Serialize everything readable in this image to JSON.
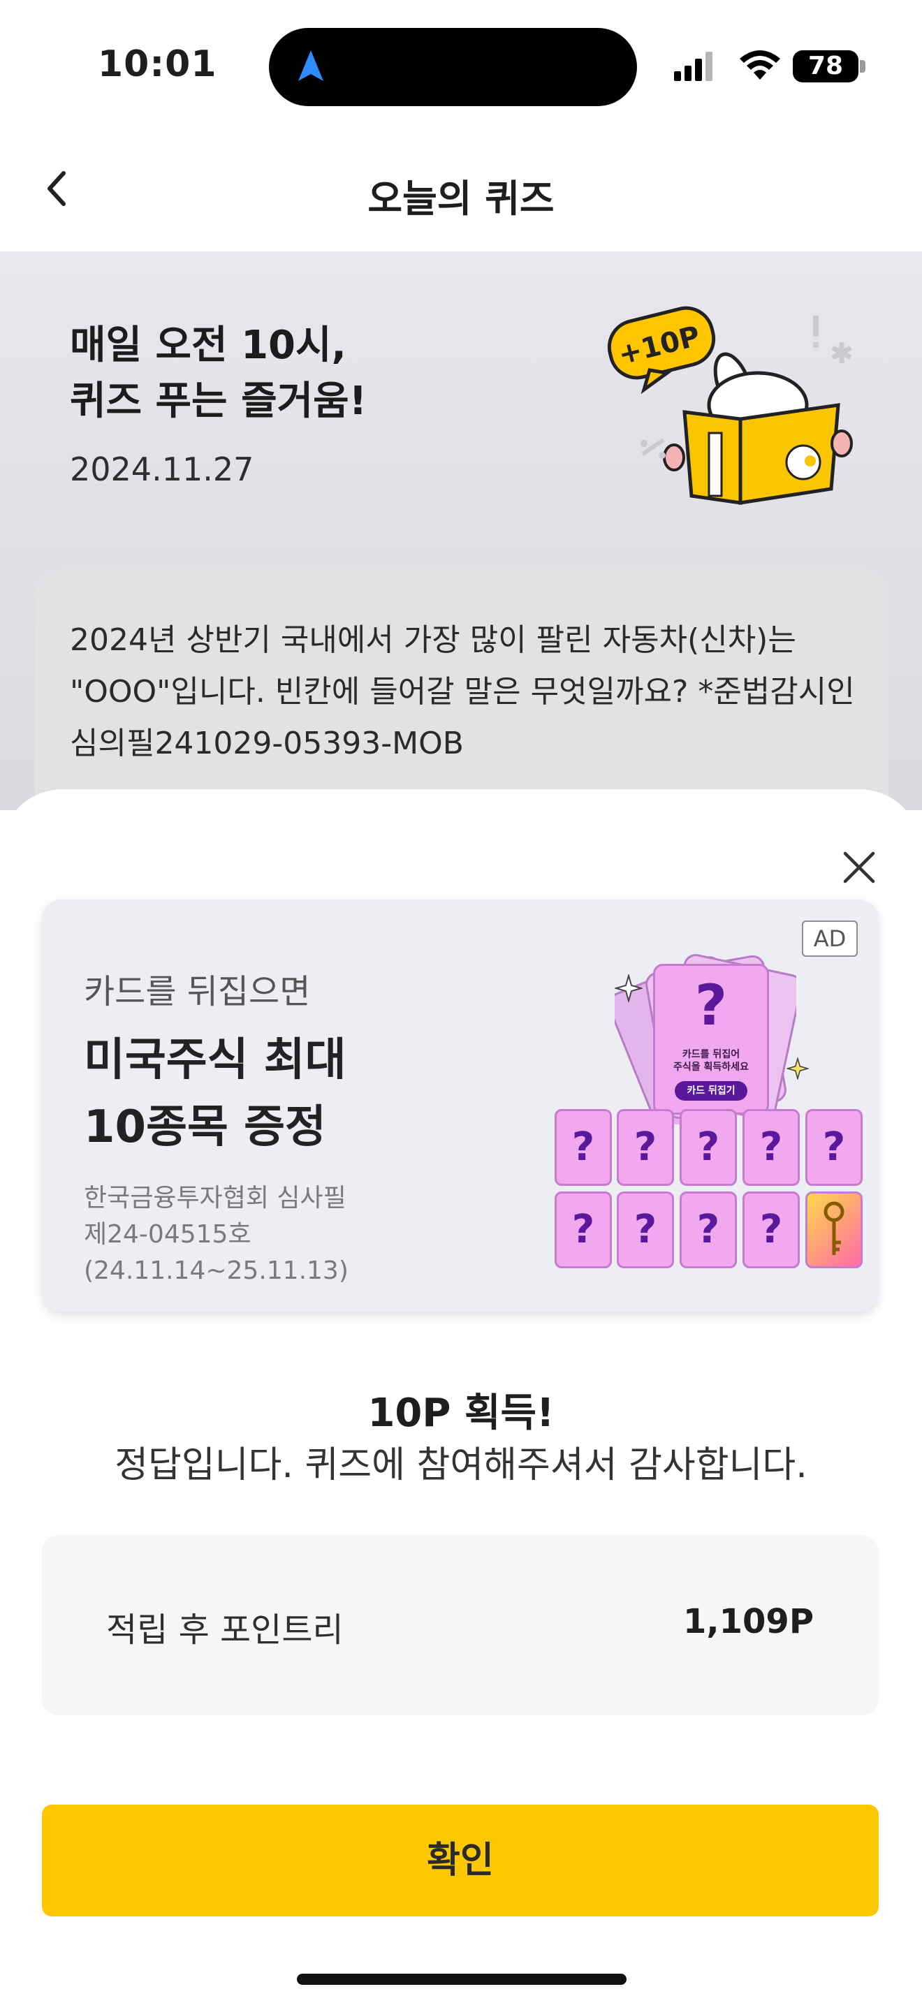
{
  "status_bar": {
    "time": "10:01",
    "battery": "78"
  },
  "nav": {
    "title": "오늘의 퀴즈"
  },
  "banner": {
    "title_line1": "매일 오전 10시,",
    "title_line2": "퀴즈 푸는 즐거움!",
    "date": "2024.11.27",
    "badge": "+10P"
  },
  "question": {
    "text": "2024년 상반기 국내에서 가장 많이 팔린 자동차(신차)는 \"OOO\"입니다. 빈칸에 들어갈 말은 무엇일까요? *준법감시인심의필241029-05393-MOB"
  },
  "ad": {
    "badge": "AD",
    "subtitle": "카드를 뒤집으면",
    "title_line1": "미국주식 최대",
    "title_line2": "10종목 증정",
    "legal_line1": "한국금융투자협회 심사필",
    "legal_line2": "제24-04515호",
    "legal_line3": "(24.11.14~25.11.13)",
    "card_caption_line1": "카드를 뒤집어",
    "card_caption_line2": "주식을 획득하세요",
    "card_button": "카드 뒤집기",
    "card_symbol": "?"
  },
  "result": {
    "title": "10P 획득!",
    "message": "정답입니다. 퀴즈에 참여해주셔서 감사합니다."
  },
  "points": {
    "label": "적립 후 포인트리",
    "value": "1,109P"
  },
  "confirm_button": "확인",
  "colors": {
    "accent": "#fdc800",
    "card_pink": "#f2a8ee",
    "card_purple": "#5a189a"
  }
}
